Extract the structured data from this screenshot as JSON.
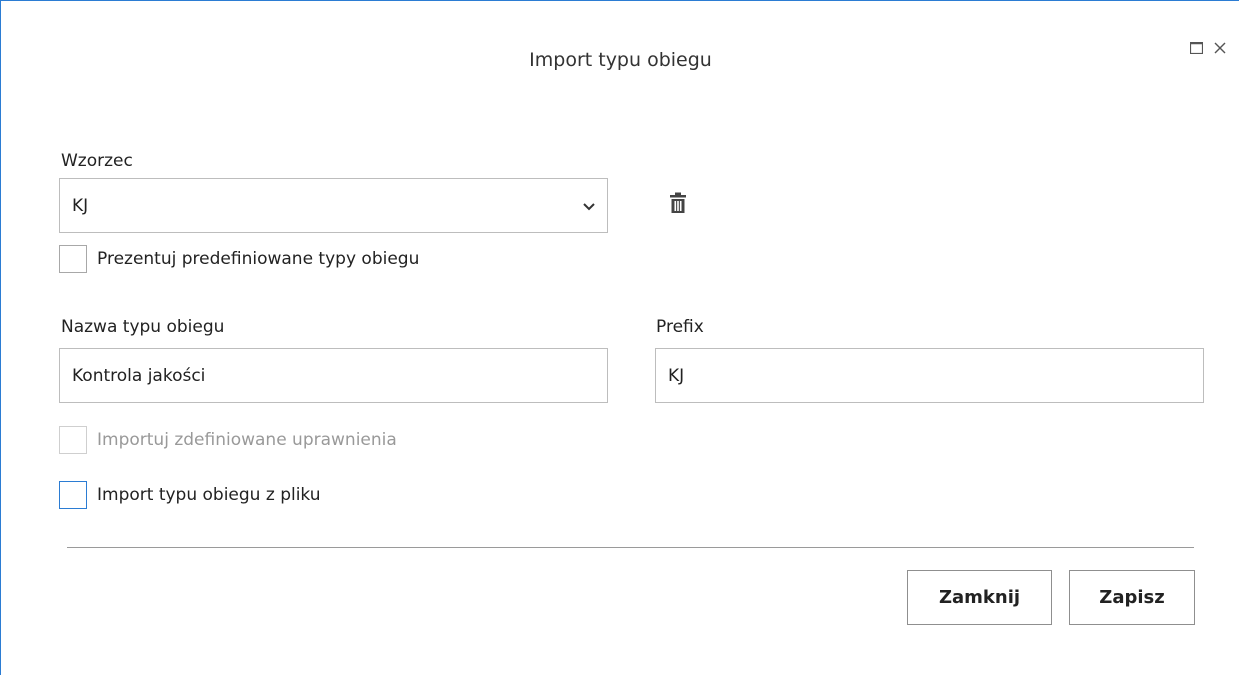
{
  "dialog": {
    "title": "Import typu obiegu"
  },
  "window_controls": {
    "maximize_icon": "maximize-icon",
    "close_icon": "close-icon"
  },
  "template": {
    "label": "Wzorzec",
    "selected_value": "KJ",
    "delete_icon": "trash-icon"
  },
  "checkboxes": {
    "show_predefined": "Prezentuj predefiniowane typy obiegu",
    "import_permissions": "Importuj zdefiniowane uprawnienia",
    "import_from_file": "Import typu obiegu z pliku"
  },
  "fields": {
    "name_label": "Nazwa typu obiegu",
    "name_value": "Kontrola jakości",
    "prefix_label": "Prefix",
    "prefix_value": "KJ"
  },
  "buttons": {
    "close": "Zamknij",
    "save": "Zapisz"
  },
  "colors": {
    "accent": "#2b7cd3",
    "disabled_text": "#999999",
    "border": "#bdbdbd"
  }
}
